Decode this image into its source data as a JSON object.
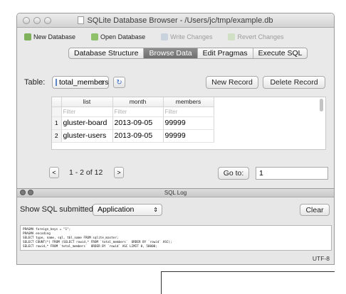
{
  "window": {
    "title": "SQLite Database Browser - /Users/jc/tmp/example.db"
  },
  "toolbar": {
    "new_database": "New Database",
    "open_database": "Open Database",
    "write_changes": "Write Changes",
    "revert_changes": "Revert Changes"
  },
  "tabs": [
    "Database Structure",
    "Browse Data",
    "Edit Pragmas",
    "Execute SQL"
  ],
  "browse": {
    "table_label": "Table:",
    "table_value": "total_members",
    "new_record": "New Record",
    "delete_record": "Delete Record",
    "columns": [
      "list",
      "month",
      "members"
    ],
    "filter_placeholder": "Filter",
    "rows": [
      {
        "num": "1",
        "list": "gluster-board",
        "month": "2013-09-05",
        "members": "99999"
      },
      {
        "num": "2",
        "list": "gluster-users",
        "month": "2013-09-05",
        "members": "99999"
      }
    ],
    "prev": "<",
    "next": ">",
    "range": "1 - 2 of 12",
    "goto_label": "Go to:",
    "goto_value": "1"
  },
  "log": {
    "title": "SQL Log",
    "show_label": "Show SQL submitted by",
    "show_value": "Application",
    "clear": "Clear",
    "lines": [
      "PRAGMA foreign_keys = \"1\";",
      "PRAGMA encoding",
      "SELECT type, name, sql, tbl_name FROM sqlite_master;",
      "SELECT COUNT(*) FROM (SELECT rowid,* FROM `total_members`  ORDER BY `rowid` ASC);",
      "SELECT rowid,* FROM `total_members`  ORDER BY `rowid` ASC LIMIT 0, 50000;"
    ],
    "encoding": "UTF-8"
  }
}
